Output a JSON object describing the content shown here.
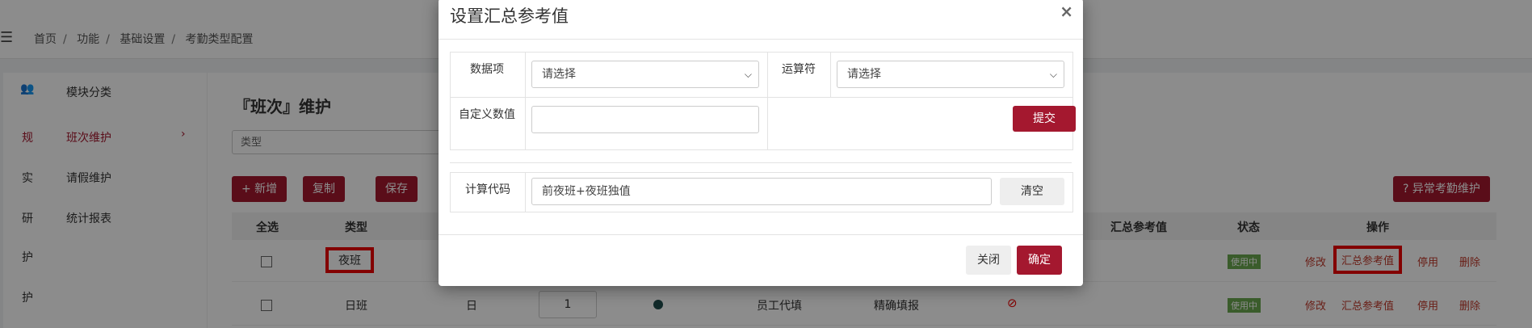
{
  "breadcrumb": [
    "首页",
    "功能",
    "基础设置",
    "考勤类型配置"
  ],
  "sidebar": {
    "group_label": "模块分类",
    "icons": [
      "规",
      "实",
      "研",
      "护",
      "护"
    ],
    "items": [
      {
        "label": "班次维护",
        "active": true,
        "arrow": "›"
      },
      {
        "label": "请假维护"
      },
      {
        "label": "统计报表"
      }
    ]
  },
  "page": {
    "title": "『班次』维护",
    "type_filter_placeholder": "类型",
    "toolbar": {
      "add": "+ 新增",
      "copy": "复制",
      "save": "保存",
      "abnormal": "? 异常考勤维护"
    }
  },
  "table": {
    "headers": {
      "select_all": "全选",
      "type": "类型",
      "summary_ref": "汇总参考值",
      "status": "状态",
      "actions": "操作"
    },
    "rows": [
      {
        "type": "夜班",
        "status": "使用中",
        "edit": "修改",
        "summary": "汇总参考值",
        "disable": "停用",
        "delete": "删除"
      },
      {
        "type": "日班",
        "day": "日",
        "qty": "1",
        "substitute": "员工代填",
        "fill_mode": "精确填报",
        "status": "使用中",
        "edit": "修改",
        "summary": "汇总参考值",
        "disable": "停用",
        "delete": "删除"
      }
    ]
  },
  "modal": {
    "title": "设置汇总参考值",
    "close_glyph": "×",
    "data_item_label": "数据项",
    "data_item_value": "请选择",
    "operator_label": "运算符",
    "operator_value": "请选择",
    "custom_value_label": "自定义数值",
    "custom_value": "",
    "submit": "提交",
    "calc_code_label": "计算代码",
    "calc_code_value": "前夜班+夜班独值",
    "clear": "清空",
    "close": "关闭",
    "confirm": "确定"
  },
  "colors": {
    "accent": "#a4182f",
    "highlight": "#ee0000",
    "status_green": "#6aa84f"
  }
}
